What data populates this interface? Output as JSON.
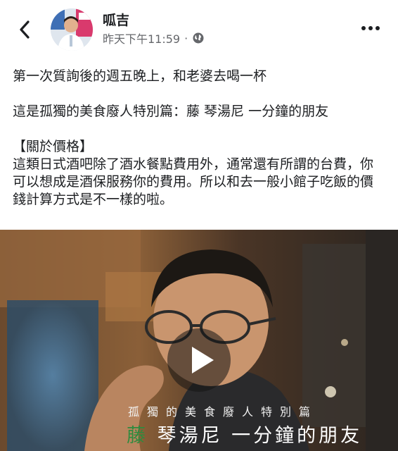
{
  "header": {
    "author_name": "呱吉",
    "timestamp": "昨天下午11:59",
    "separator": "·",
    "privacy_icon": "globe-icon",
    "back_icon": "chevron-left-icon",
    "more_icon": "more-dots-icon"
  },
  "post": {
    "paragraphs": [
      "第一次質詢後的週五晚上，和老婆去喝一杯",
      "這是孤獨的美食廢人特別篇：藤 琴湯尼 一分鐘的朋友",
      "【關於價格】",
      "這類日式酒吧除了酒水餐點費用外，通常還有所謂的台費，你可以想成是酒保服務你的費用。所以和去一般小館子吃飯的價錢計算方式是不一樣的啦。"
    ]
  },
  "video": {
    "play_icon": "play-icon",
    "caption_small": "孤獨的美食廢人特別篇",
    "caption_first_char": "藤",
    "caption_rest": " 琴湯尼 一分鐘的朋友"
  },
  "colors": {
    "text": "#1c1e21",
    "meta": "#65676b",
    "caption_accent": "#2e8b3e"
  }
}
